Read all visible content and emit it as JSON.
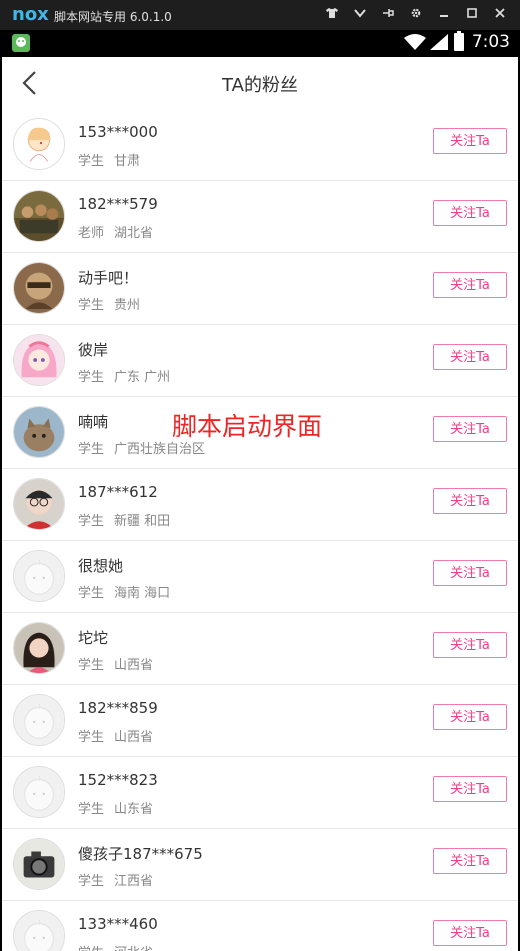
{
  "emulator": {
    "logo": "nox",
    "title": "脚本网站专用 6.0.1.0",
    "controls": [
      "shirt-icon",
      "chevron-down-icon",
      "pin-icon",
      "gear-icon",
      "minimize-icon",
      "maximize-icon",
      "close-icon"
    ]
  },
  "status_bar": {
    "time": "7:03"
  },
  "header": {
    "title": "TA的粉丝"
  },
  "fans": [
    {
      "name": "153***000",
      "role": "学生",
      "location": "甘肃",
      "avatar": "sketch",
      "follow_label": "关注Ta"
    },
    {
      "name": "182***579",
      "role": "老师",
      "location": "湖北省",
      "avatar": "photo-group",
      "follow_label": "关注Ta"
    },
    {
      "name": "动手吧！",
      "role": "学生",
      "location": "贵州",
      "avatar": "photo-sepia",
      "follow_label": "关注Ta"
    },
    {
      "name": "彼岸",
      "role": "学生",
      "location": "广东 广州",
      "avatar": "anime-girl",
      "follow_label": "关注Ta"
    },
    {
      "name": "喃喃",
      "role": "学生",
      "location": "广西壮族自治区",
      "avatar": "cat",
      "follow_label": "关注Ta"
    },
    {
      "name": "187***612",
      "role": "学生",
      "location": "新疆 和田",
      "avatar": "photo-person",
      "follow_label": "关注Ta"
    },
    {
      "name": "很想她",
      "role": "学生",
      "location": "海南 海口",
      "avatar": "default",
      "follow_label": "关注Ta"
    },
    {
      "name": "坨坨",
      "role": "学生",
      "location": "山西省",
      "avatar": "photo-girl",
      "follow_label": "关注Ta"
    },
    {
      "name": "182***859",
      "role": "学生",
      "location": "山西省",
      "avatar": "default",
      "follow_label": "关注Ta"
    },
    {
      "name": "152***823",
      "role": "学生",
      "location": "山东省",
      "avatar": "default",
      "follow_label": "关注Ta"
    },
    {
      "name": "傻孩子187***675",
      "role": "学生",
      "location": "江西省",
      "avatar": "photo-camera",
      "follow_label": "关注Ta"
    },
    {
      "name": "133***460",
      "role": "学生",
      "location": "河北省",
      "avatar": "default",
      "follow_label": "关注Ta"
    }
  ],
  "overlay_text": "脚本启动界面",
  "colors": {
    "accent": "#ea3f86",
    "border": "#f27aa9",
    "emulator_bar": "#1e1e1e"
  }
}
